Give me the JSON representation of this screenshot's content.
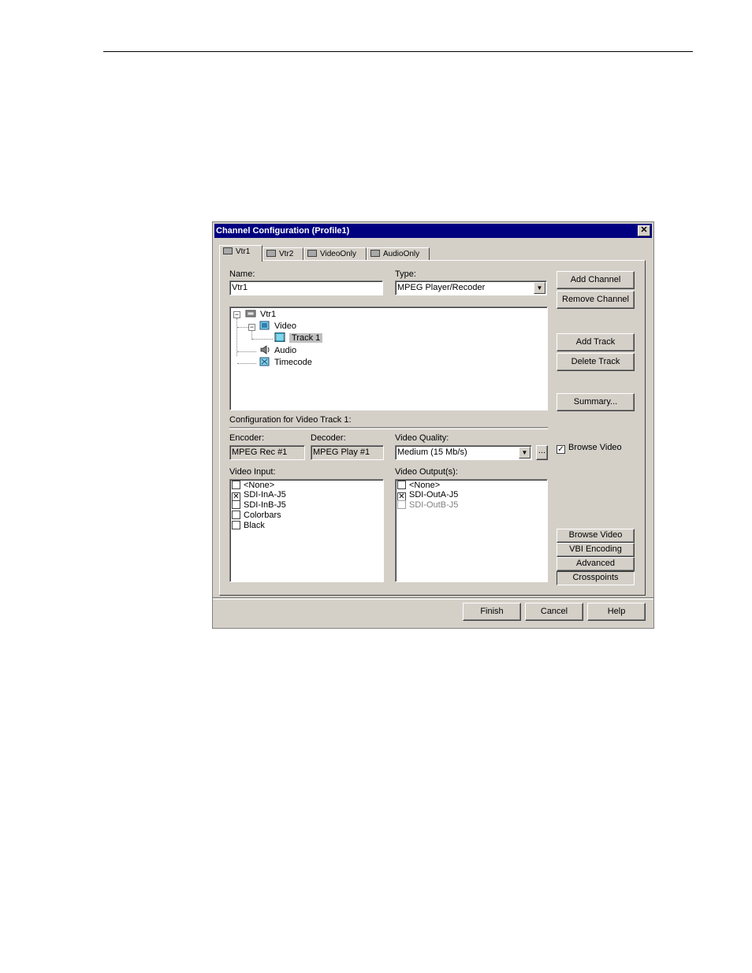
{
  "dialog": {
    "title": "Channel Configuration (Profile1)",
    "close_glyph": "✕"
  },
  "tabs": [
    {
      "label": "Vtr1",
      "icon": "vtr-icon",
      "active": true
    },
    {
      "label": "Vtr2",
      "icon": "vtr-icon",
      "active": false
    },
    {
      "label": "VideoOnly",
      "icon": "vtr-icon",
      "active": false
    },
    {
      "label": "AudioOnly",
      "icon": "vtr-icon",
      "active": false
    }
  ],
  "form": {
    "name_label": "Name:",
    "name_value": "Vtr1",
    "type_label": "Type:",
    "type_value": "MPEG Player/Recoder"
  },
  "tree": {
    "root": "Vtr1",
    "video": "Video",
    "track": "Track 1",
    "audio": "Audio",
    "timecode": "Timecode"
  },
  "side_buttons": {
    "add_channel": "Add Channel",
    "remove_channel": "Remove Channel",
    "add_track": "Add Track",
    "delete_track": "Delete Track",
    "summary": "Summary..."
  },
  "config": {
    "heading": "Configuration for Video Track 1:",
    "encoder_label": "Encoder:",
    "encoder_value": "MPEG Rec #1",
    "decoder_label": "Decoder:",
    "decoder_value": "MPEG Play #1",
    "quality_label": "Video Quality:",
    "quality_value": "Medium (15 Mb/s)",
    "ellipsis": "...",
    "browse_checkbox_label": "Browse Video",
    "browse_checked": true
  },
  "video_input": {
    "label": "Video Input:",
    "items": [
      {
        "text": "<None>",
        "checked": false
      },
      {
        "text": "SDI-InA-J5",
        "checked": true
      },
      {
        "text": "SDI-InB-J5",
        "checked": false
      },
      {
        "text": "Colorbars",
        "checked": false
      },
      {
        "text": "Black",
        "checked": false
      }
    ]
  },
  "video_output": {
    "label": "Video Output(s):",
    "items": [
      {
        "text": "<None>",
        "checked": false,
        "disabled": false
      },
      {
        "text": "SDI-OutA-J5",
        "checked": true,
        "disabled": false
      },
      {
        "text": "SDI-OutB-J5",
        "checked": false,
        "disabled": true
      }
    ]
  },
  "lower_buttons": {
    "browse_video": "Browse Video",
    "vbi_encoding": "VBI Encoding",
    "advanced": "Advanced",
    "crosspoints": "Crosspoints"
  },
  "footer": {
    "finish": "Finish",
    "cancel": "Cancel",
    "help": "Help"
  }
}
